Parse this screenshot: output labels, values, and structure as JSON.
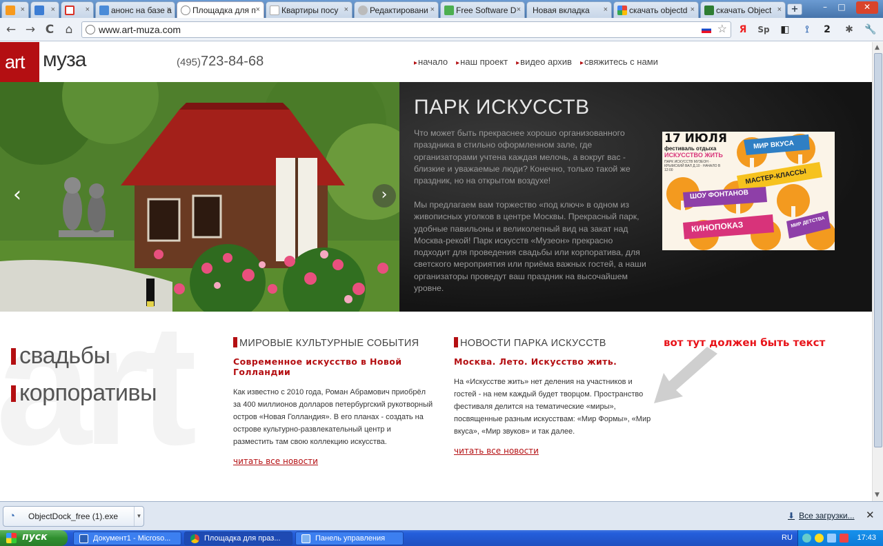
{
  "browser": {
    "tabs": [
      {
        "label": "",
        "favicon_color": "#f79a1e"
      },
      {
        "label": "",
        "favicon_color": "#3c7dd4"
      },
      {
        "label": "",
        "favicon_color": "#d93025"
      },
      {
        "label": "анонс на базе а",
        "favicon_color": "#4a8bd8"
      },
      {
        "label": "Площадка для п",
        "favicon_color": "#999999",
        "active": true
      },
      {
        "label": "Квартиры посу",
        "favicon_color": "#ffffff"
      },
      {
        "label": "Редактировани",
        "favicon_color": "#888888"
      },
      {
        "label": "Free Software D",
        "favicon_color": "#4caf50"
      },
      {
        "label": "Новая вкладка",
        "favicon_color": ""
      },
      {
        "label": "скачать objectd",
        "favicon_color": "#4285f4"
      },
      {
        "label": "скачать Object",
        "favicon_color": "#2e7d32"
      }
    ],
    "new_tab": "+",
    "window_controls": [
      "–",
      "□",
      "✕"
    ],
    "nav": {
      "back": "←",
      "forward": "→",
      "reload": "C",
      "home": "⌂"
    },
    "url": "www.art-muza.com",
    "extensions": [
      "Я",
      "Sp",
      "◧",
      "⟟",
      "2",
      "✱",
      "🔧"
    ]
  },
  "site": {
    "logo_art": "art",
    "logo_muza": "муза",
    "phone_code": "(495)",
    "phone_number": "723-84-68",
    "nav": [
      "начало",
      "наш проект",
      "видео архив",
      "свяжитесь с нами"
    ],
    "hero": {
      "title": "ПАРК ИСКУССТВ",
      "p1": "Что может быть прекраснее хорошо организованного праздника в стильно оформленном зале, где организаторами учтена каждая мелочь, а вокруг вас - близкие и уважаемые люди? Конечно, только такой же праздник, но на открытом воздухе!",
      "p2": "Мы предлагаем вам торжество «под ключ» в одном из живописных уголков в центре Москвы. Прекрасный парк, удобные павильоны и великолепный вид на закат над Москва-рекой! Парк искусств «Музеон» прекрасно подходит для проведения свадьбы или корпоратива, для светского мероприятия или приёма важных гостей, а наши организаторы проведут ваш праздник на высочайшем уровне.",
      "prev": "‹",
      "next": "›",
      "poster": {
        "date": "17 ИЮЛЯ",
        "subtitle": "фестиваль отдыха",
        "name": "ИСКУССТВО ЖИТЬ",
        "small": "ПАРК ИСКУССТВ МУЗЕОН · КРЫМСКИЙ ВАЛ Д.10 · НАЧАЛО В 12:00",
        "ribbons": [
          "МИР ВКУСА",
          "МАСТЕР-КЛАССЫ",
          "ШОУ ФОНТАНОВ",
          "КИНОПОКАЗ",
          "МИР ДЕТСТВА"
        ]
      }
    },
    "watermark": "art",
    "side_links": [
      "свадьбы",
      "корпоративы"
    ],
    "columns": [
      {
        "head": "МИРОВЫЕ КУЛЬТУРНЫЕ СОБЫТИЯ",
        "sub": "Современное искусство в Новой Голландии",
        "body": "Как известно с 2010 года, Роман Абрамович приобрёл за 400 миллионов долларов петербургский рукотворный остров «Новая Голландия». В его планах - создать на острове культурно-развлекательный центр и разместить там свою коллекцию искусства.",
        "more": "читать все новости"
      },
      {
        "head": "НОВОСТИ ПАРКА ИСКУССТВ",
        "sub": "Москва. Лето. Искусство жить.",
        "body": "На «Искусстве жить» нет деления на участников и гостей - на нем каждый будет творцом. Пространство фестиваля делится на тематические «миры», посвященные разным искусствам: «Мир Формы», «Мир вкуса», «Мир звуков» и так далее.",
        "more": "читать все новости"
      }
    ],
    "annotation": "вот тут должен быть текст"
  },
  "downloads": {
    "file": "ObjectDock_free (1).exe",
    "all": "Все загрузки...",
    "close": "✕"
  },
  "taskbar": {
    "start": "пуск",
    "tasks": [
      {
        "label": "Документ1 - Microso...",
        "icon_color": "#2b5fb4"
      },
      {
        "label": "Площадка для праз...",
        "icon_color": "#e8b41c",
        "active": true
      },
      {
        "label": "Панель управления",
        "icon_color": "#7fb2f0"
      }
    ],
    "lang": "RU",
    "clock": "17:43"
  }
}
